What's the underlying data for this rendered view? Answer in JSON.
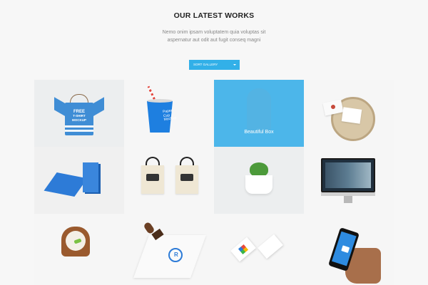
{
  "header": {
    "title": "OUR LATEST WORKS",
    "subtitle_line1": "Nemo onim ipsam voluptatem quia voluptas sit",
    "subtitle_line2": "aspernatur aut odit aut fugit conseq magni"
  },
  "sort": {
    "label": "SORT GALLERY",
    "icon": "caret-down-icon",
    "color": "#32b0e8"
  },
  "gallery": {
    "items": [
      {
        "name": "tshirt-mockup",
        "text_line1": "FREE",
        "text_line2": "T-SHIRT",
        "text_line3": "MOCKUP"
      },
      {
        "name": "paper-cup-mockup",
        "text_line1": "Paper",
        "text_line2": "Cup",
        "text_line3": "Mockup"
      },
      {
        "name": "beautiful-box",
        "caption": "Beautiful Box",
        "highlighted": true,
        "overlay_color": "#40b1e9"
      },
      {
        "name": "envelope-on-wood"
      },
      {
        "name": "book-mockup"
      },
      {
        "name": "tote-bags-mockup"
      },
      {
        "name": "plant-pot"
      },
      {
        "name": "monitor-mockup"
      },
      {
        "name": "wooden-clock"
      },
      {
        "name": "stamp-mockup"
      },
      {
        "name": "business-cards"
      },
      {
        "name": "phone-in-hand"
      }
    ]
  }
}
